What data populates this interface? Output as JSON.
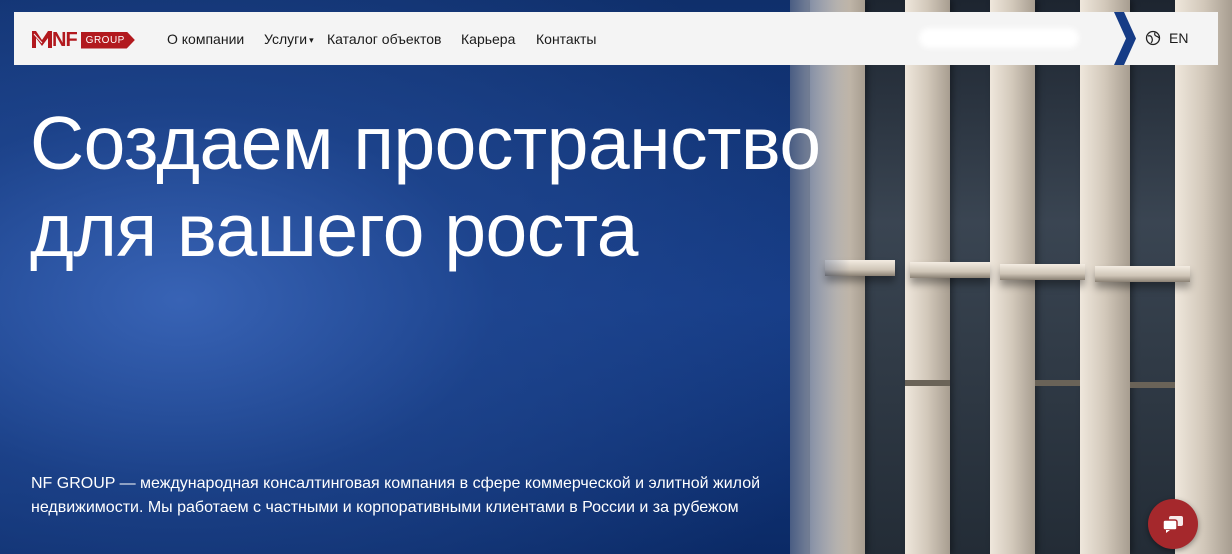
{
  "header": {
    "logo": {
      "mark": "NF",
      "tag": "GROUP"
    },
    "nav": [
      {
        "label": "О компании"
      },
      {
        "label": "Услуги",
        "has_dropdown": true
      },
      {
        "label": "Каталог объектов"
      },
      {
        "label": "Карьера"
      },
      {
        "label": "Контакты"
      }
    ],
    "language": "EN"
  },
  "hero": {
    "title_line1": "Создаем пространство",
    "title_line2": "для вашего роста",
    "description": "NF GROUP — международная консалтинговая компания в сфере коммерческой и элитной жилой недвижимости. Мы работаем с частными и корпоративными клиентами в России и за рубежом"
  },
  "colors": {
    "brand": "#b2191e",
    "chat_button": "#a5282c",
    "hero_bg": "#163c86",
    "header_bg": "#f4f4f4"
  },
  "icons": {
    "language": "globe-icon",
    "chat": "chat-icon",
    "dropdown": "chevron-down-icon"
  }
}
